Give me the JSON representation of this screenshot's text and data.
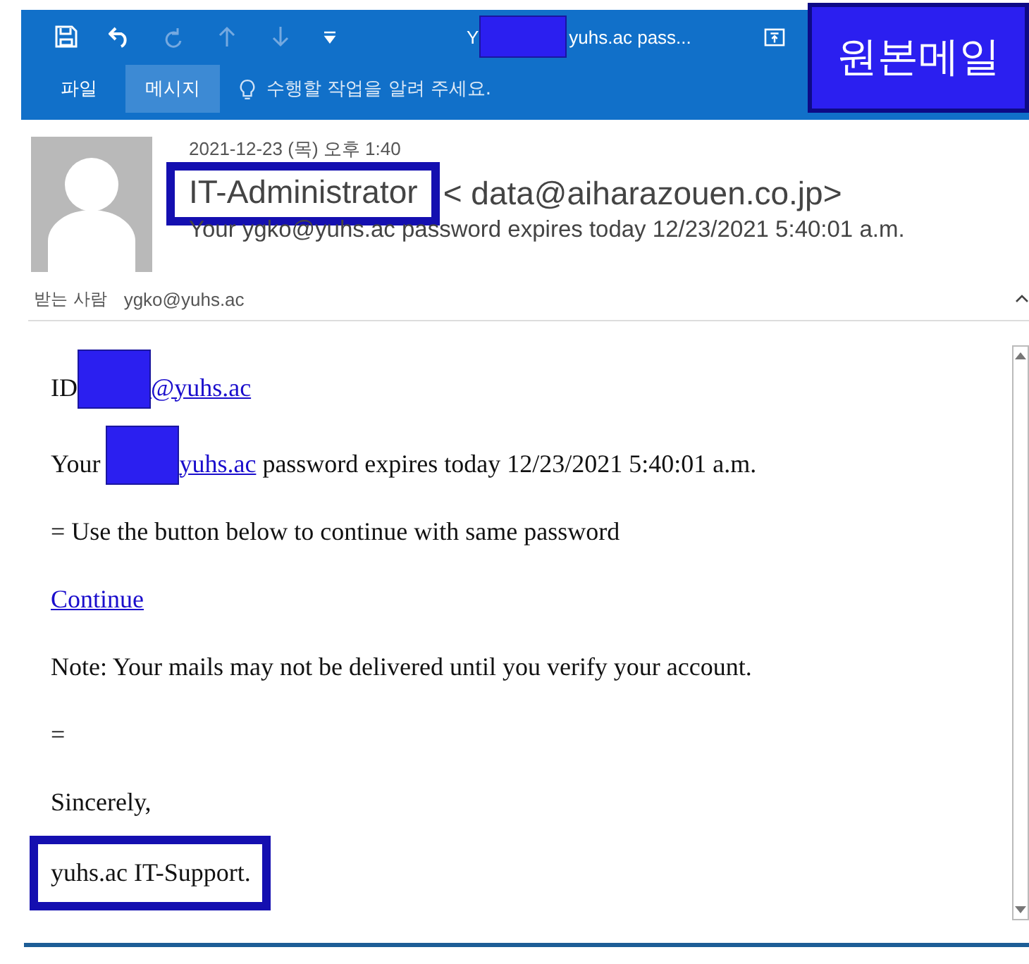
{
  "window": {
    "title_start": "Y",
    "title_end": "yuhs.ac pass..."
  },
  "tabs": [
    {
      "label": "파일",
      "selected": false
    },
    {
      "label": "메시지",
      "selected": true
    }
  ],
  "tell_me": {
    "placeholder": "수행할 작업을 알려 주세요."
  },
  "overlay_label": "원본메일",
  "header": {
    "date": "2021-12-23 (목) 오후 1:40",
    "sender_name": "IT-Administrator",
    "sender_address": "< data@aiharazouen.co.jp>",
    "subject": "Your ygko@yuhs.ac password expires today 12/23/2021 5:40:01 a.m.",
    "to_label": "받는 사람",
    "to_address": "ygko@yuhs.ac"
  },
  "body": {
    "id_label": "ID",
    "id_link": "@yuhs.ac",
    "your": "Your",
    "your_link": "yuhs.ac",
    "expires": "password expires today 12/23/2021 5:40:01 a.m.",
    "instruction": "= Use the button below to continue with same password",
    "continue_link": "Continue",
    "note": "Note: Your mails may not be delivered until you verify your account.",
    "separator": "=",
    "closing": "Sincerely,",
    "signature": "yuhs.ac IT-Support."
  }
}
